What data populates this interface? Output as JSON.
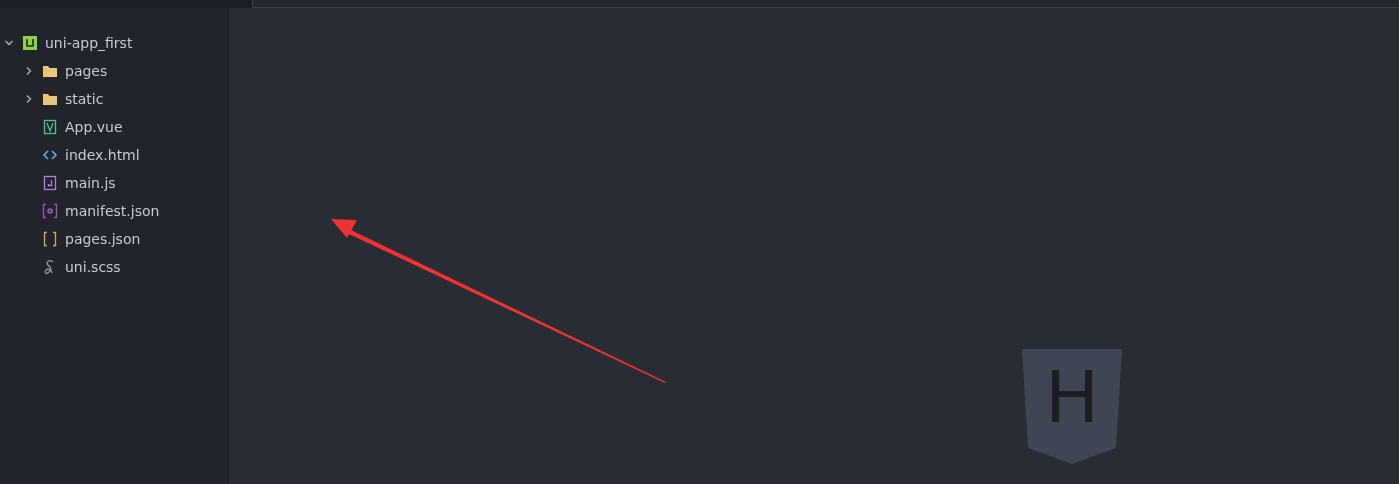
{
  "project_tree": [
    {
      "label": "uni-app_first",
      "kind": "project",
      "expanded": true,
      "children": [
        {
          "label": "pages",
          "kind": "folder",
          "expanded": false
        },
        {
          "label": "static",
          "kind": "folder",
          "expanded": false
        },
        {
          "label": "App.vue",
          "kind": "vue"
        },
        {
          "label": "index.html",
          "kind": "html"
        },
        {
          "label": "main.js",
          "kind": "js"
        },
        {
          "label": "manifest.json",
          "kind": "manifest"
        },
        {
          "label": "pages.json",
          "kind": "json"
        },
        {
          "label": "uni.scss",
          "kind": "scss"
        }
      ]
    }
  ],
  "editor": {
    "logo_letter": "H",
    "annotation": {
      "kind": "arrow"
    }
  }
}
